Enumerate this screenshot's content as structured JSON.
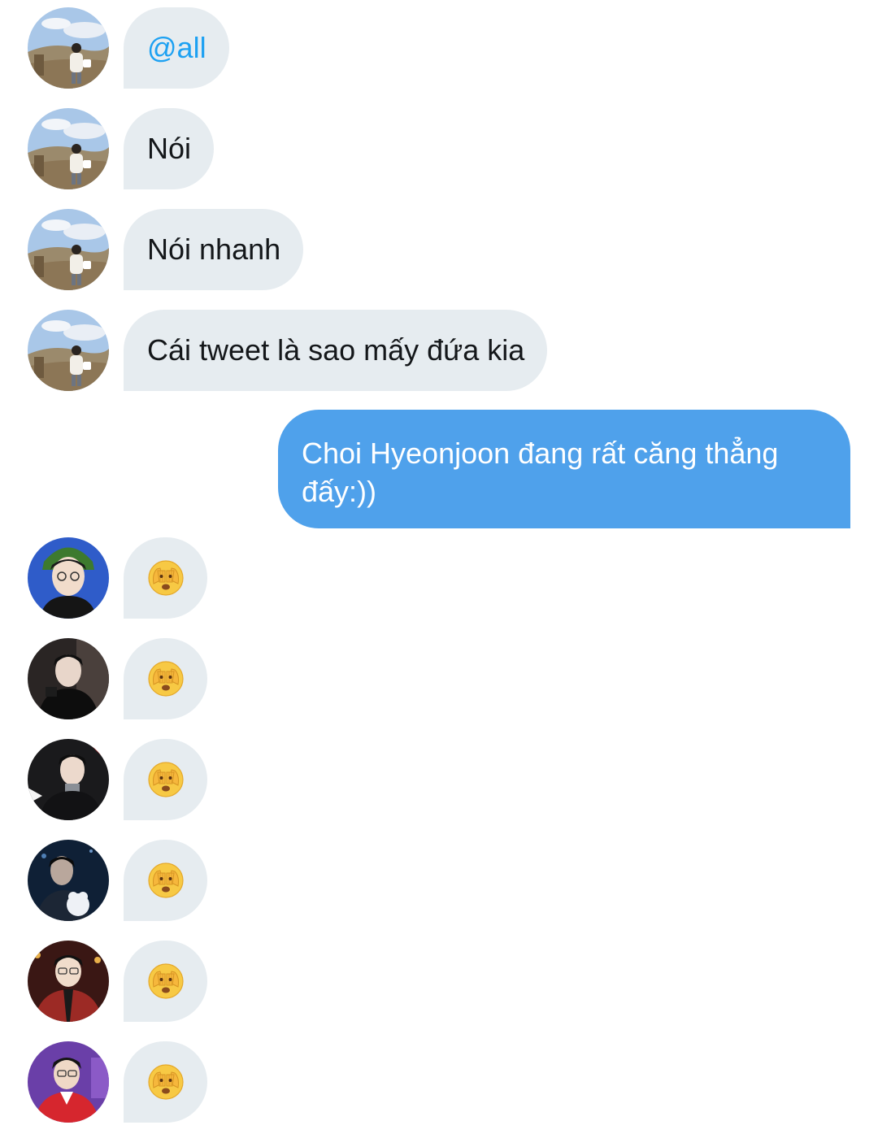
{
  "messages": [
    {
      "type": "incoming",
      "avatar": "landscape-user-avatar",
      "text": "@all",
      "mention": true
    },
    {
      "type": "incoming",
      "avatar": "landscape-user-avatar",
      "text": "Nói"
    },
    {
      "type": "incoming",
      "avatar": "landscape-user-avatar",
      "text": "Nói nhanh"
    },
    {
      "type": "incoming",
      "avatar": "landscape-user-avatar",
      "text": "Cái tweet là sao mấy đứa kia"
    },
    {
      "type": "outgoing",
      "text": "Choi Hyeonjoon đang rất căng thẳng đấy:))"
    },
    {
      "type": "reaction",
      "avatar": "user-avatar-blue",
      "emoji": "face-with-hand-over-eyes-emoji"
    },
    {
      "type": "reaction",
      "avatar": "user-avatar-dark",
      "emoji": "face-with-hand-over-eyes-emoji"
    },
    {
      "type": "reaction",
      "avatar": "user-avatar-black-suit",
      "emoji": "face-with-hand-over-eyes-emoji"
    },
    {
      "type": "reaction",
      "avatar": "user-avatar-night",
      "emoji": "face-with-hand-over-eyes-emoji"
    },
    {
      "type": "reaction",
      "avatar": "user-avatar-red-plaid",
      "emoji": "face-with-hand-over-eyes-emoji"
    },
    {
      "type": "reaction",
      "avatar": "user-avatar-purple",
      "emoji": "face-with-hand-over-eyes-emoji"
    }
  ],
  "colors": {
    "incoming_bubble": "#e6ecf0",
    "outgoing_bubble": "#4fa1eb",
    "mention": "#1da1f2",
    "text": "#14171a"
  }
}
